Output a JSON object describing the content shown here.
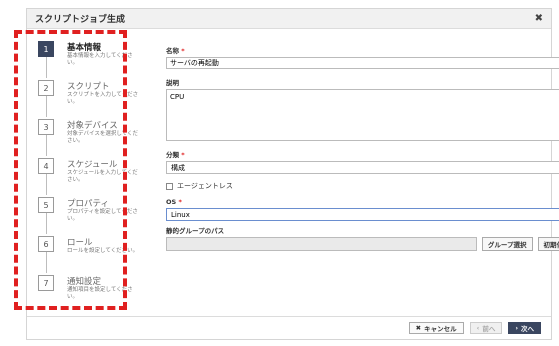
{
  "dialog": {
    "title": "スクリプトジョブ生成",
    "close_glyph": "✖"
  },
  "steps": [
    {
      "num": "1",
      "label": "基本情報",
      "desc": "基本情報を入力してください。",
      "active": true
    },
    {
      "num": "2",
      "label": "スクリプト",
      "desc": "スクリプトを入力してください。",
      "active": false
    },
    {
      "num": "3",
      "label": "対象デバイス",
      "desc": "対象デバイスを選択してください。",
      "active": false
    },
    {
      "num": "4",
      "label": "スケジュール",
      "desc": "スケジュールを入力してください。",
      "active": false
    },
    {
      "num": "5",
      "label": "プロパティ",
      "desc": "プロパティを設定してください。",
      "active": false
    },
    {
      "num": "6",
      "label": "ロール",
      "desc": "ロールを設定してください。",
      "active": false
    },
    {
      "num": "7",
      "label": "通知設定",
      "desc": "通知項目を設定してください。",
      "active": false
    }
  ],
  "form": {
    "name_label": "名称",
    "name_value": "サーバの再起動",
    "desc_label": "説明",
    "desc_value": "CPU",
    "category_label": "分類",
    "category_value": "構成",
    "agentless_label": "エージェントレス",
    "os_label": "OS",
    "os_value": "Linux",
    "group_path_label": "静的グループのパス",
    "group_select_btn": "グループ選択",
    "reset_btn": "初期化",
    "required_mark": "*"
  },
  "footer": {
    "cancel": "キャンセル",
    "prev": "前へ",
    "next": "次へ"
  },
  "colors": {
    "accent": "#3a4660",
    "highlight_dashes": "#e02020"
  }
}
